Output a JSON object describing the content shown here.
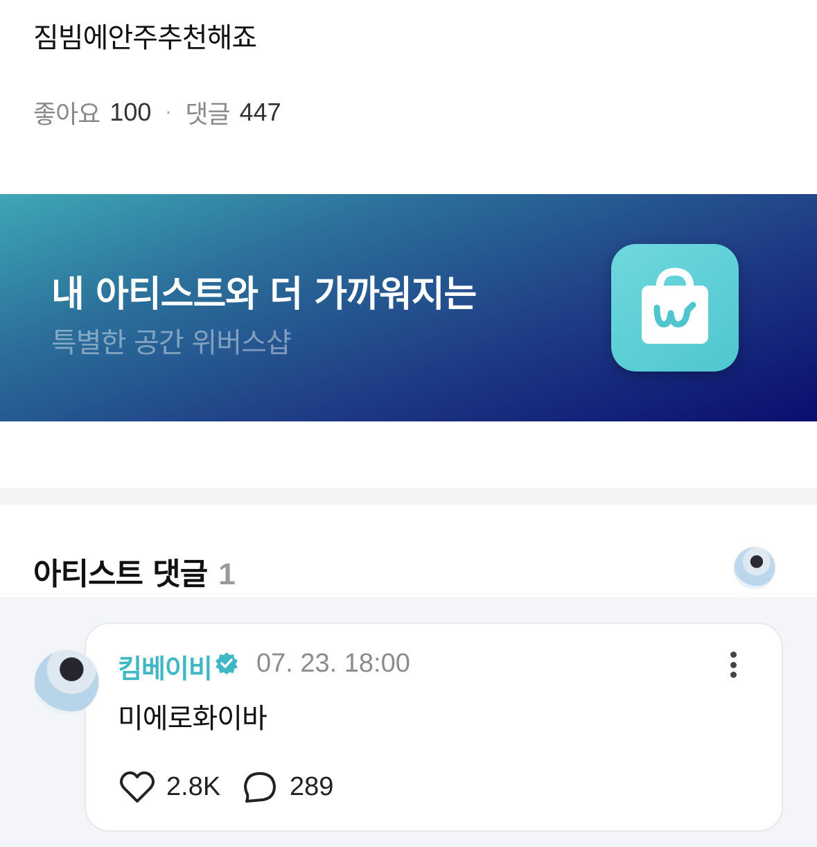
{
  "post": {
    "body": "짐빔에안주추천해죠",
    "likes_label": "좋아요",
    "likes_count": "100",
    "separator": "·",
    "comments_label": "댓글",
    "comments_count": "447"
  },
  "banner": {
    "title": "내 아티스트와 더 가까워지는",
    "subtitle": "특별한 공간 위버스샵",
    "icon": "weverse-shop-bag-icon"
  },
  "artist_comments": {
    "title": "아티스트 댓글",
    "count": "1"
  },
  "comment": {
    "author": "킴베이비",
    "verified_icon": "verified-badge-icon",
    "time": "07. 23. 18:00",
    "text": "미에로화이바",
    "likes": "2.8K",
    "replies": "289"
  },
  "colors": {
    "accent": "#3fb7c4",
    "banner_start": "#3fa7b5",
    "banner_end": "#0b0d6e"
  }
}
